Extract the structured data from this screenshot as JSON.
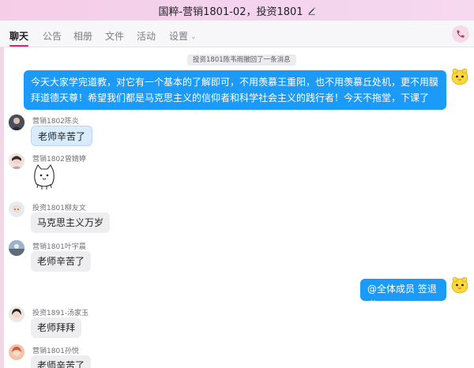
{
  "window": {
    "title": "国粹-营销1801-02，投资1801"
  },
  "tabs": [
    {
      "label": "聊天"
    },
    {
      "label": "公告"
    },
    {
      "label": "相册"
    },
    {
      "label": "文件"
    },
    {
      "label": "活动"
    },
    {
      "label": "设置"
    }
  ],
  "colors": {
    "self_bubble": "#1b9af7",
    "other_bubble": "#eeeef1",
    "accent": "#e61e7a",
    "titlebar": "#f3d3ee"
  },
  "chat": {
    "system_notice": "投资1801陈韦雨撤回了一条消息",
    "self_message_1": "今天大家学完道教，对它有一个基本的了解即可，不用羡慕王重阳，也不用羡慕丘处机，更不用膜拜道德天尊！希望我们都是马克思主义的信仰者和科学社会主义的践行者！今天不拖堂，下课了",
    "msg_1": {
      "sender": "营销1802陈炎",
      "text": "老师辛苦了"
    },
    "msg_2": {
      "sender": "营销1802曾婧婷",
      "sticker": "cat-sticker"
    },
    "msg_3": {
      "sender": "投资1801柳友文",
      "text": "马克思主义万岁"
    },
    "msg_4": {
      "sender": "营销1801叶宇晨",
      "text": "老师辛苦了"
    },
    "self_message_2": "@全体成员 签退啦",
    "msg_5": {
      "sender": "投资1891-汤家玉",
      "text": "老师拜拜"
    },
    "msg_6": {
      "sender": "营销1801孙悦",
      "text": "老师辛苦了"
    }
  }
}
